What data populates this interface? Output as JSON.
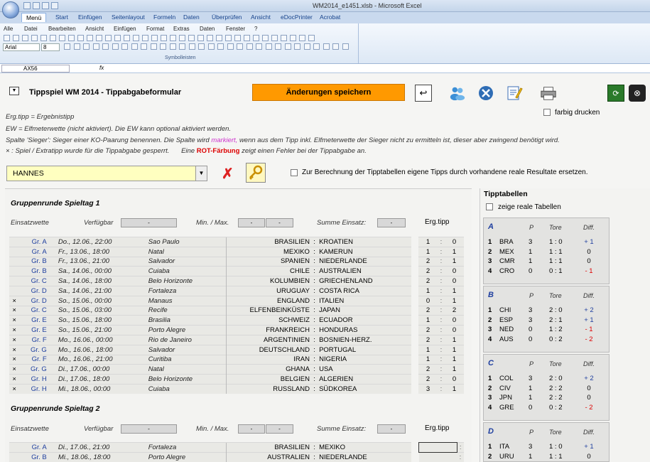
{
  "window": {
    "title": "WM2014_e1451.xlsb - Microsoft Excel"
  },
  "ribbon": {
    "tabs": [
      "Menü",
      "Start",
      "Einfügen",
      "Seitenlayout",
      "Formeln",
      "Daten",
      "Überprüfen",
      "Ansicht",
      "eDocPrinter",
      "Acrobat"
    ],
    "menus": [
      "Alle",
      "Datei",
      "Bearbeiten",
      "Ansicht",
      "Einfügen",
      "Format",
      "Extras",
      "Daten",
      "Fenster",
      "?"
    ],
    "font_name": "Arial",
    "font_size": "8",
    "group_label": "Symbolleisten"
  },
  "formula_bar": {
    "name_box": "AX56",
    "fx": "fx"
  },
  "header": {
    "title": "Tippspiel WM 2014 - Tippabgabeformular",
    "save_label": "Änderungen speichern",
    "color_print_label": "farbig drucken"
  },
  "info": {
    "line1": "Erg.tipp = Ergebnistipp",
    "line2": "EW = Elfmeterwette (nicht aktiviert). Die EW kann optional aktiviert werden.",
    "line3a": "Spalte 'Sieger': Sieger einer KO-Paarung benennen. Die Spalte wird",
    "line3b": "markiert,",
    "line3c": "wenn aus dem Tipp inkl. Elfmeterwette der Sieger nicht zu ermitteln ist, dieser aber zwingend benötigt wird.",
    "line4a": "× : Spiel / Extratipp wurde für die Tippabgabe gesperrt.",
    "line4b": "Eine",
    "line4c": "ROT-Färbung",
    "line4d": "zeigt einen Fehler bei der Tippabgabe an."
  },
  "player": {
    "name": "HANNES",
    "replace_label": "Zur Berechnung der Tipptabellen eigene Tipps durch vorhandene reale Resultate ersetzen."
  },
  "section1": {
    "title": "Gruppenrunde Spieltag 1",
    "einsatz": "Einsatzwette",
    "verfuegbar": "Verfügbar",
    "verf_val": "-",
    "minmax": "Min. / Max.",
    "min_val": "-",
    "max_val": "-",
    "summe": "Summe Einsatz:",
    "summe_val": "-",
    "ergtipp": "Erg.tipp",
    "matches": [
      {
        "g": "Gr. A",
        "m": "",
        "d": "Do., 12.06., 22:00",
        "v": "Sao Paulo",
        "h": "BRASILIEN",
        "a": "KROATIEN",
        "t1": "1",
        "t2": "0"
      },
      {
        "g": "Gr. A",
        "m": "",
        "d": "Fr., 13.06., 18:00",
        "v": "Natal",
        "h": "MEXIKO",
        "a": "KAMERUN",
        "t1": "1",
        "t2": "1"
      },
      {
        "g": "Gr. B",
        "m": "",
        "d": "Fr., 13.06., 21:00",
        "v": "Salvador",
        "h": "SPANIEN",
        "a": "NIEDERLANDE",
        "t1": "2",
        "t2": "1"
      },
      {
        "g": "Gr. B",
        "m": "",
        "d": "Sa., 14.06., 00:00",
        "v": "Cuiaba",
        "h": "CHILE",
        "a": "AUSTRALIEN",
        "t1": "2",
        "t2": "0"
      },
      {
        "g": "Gr. C",
        "m": "",
        "d": "Sa., 14.06., 18:00",
        "v": "Belo Horizonte",
        "h": "KOLUMBIEN",
        "a": "GRIECHENLAND",
        "t1": "2",
        "t2": "0"
      },
      {
        "g": "Gr. D",
        "m": "",
        "d": "Sa., 14.06., 21:00",
        "v": "Fortaleza",
        "h": "URUGUAY",
        "a": "COSTA RICA",
        "t1": "1",
        "t2": "1"
      },
      {
        "g": "Gr. D",
        "m": "×",
        "d": "So., 15.06., 00:00",
        "v": "Manaus",
        "h": "ENGLAND",
        "a": "ITALIEN",
        "t1": "0",
        "t2": "1"
      },
      {
        "g": "Gr. C",
        "m": "×",
        "d": "So., 15.06., 03:00",
        "v": "Recife",
        "h": "ELFENBEINKÜSTE",
        "a": "JAPAN",
        "t1": "2",
        "t2": "2"
      },
      {
        "g": "Gr. E",
        "m": "×",
        "d": "So., 15.06., 18:00",
        "v": "Brasilia",
        "h": "SCHWEIZ",
        "a": "ECUADOR",
        "t1": "1",
        "t2": "0"
      },
      {
        "g": "Gr. E",
        "m": "×",
        "d": "So., 15.06., 21:00",
        "v": "Porto Alegre",
        "h": "FRANKREICH",
        "a": "HONDURAS",
        "t1": "2",
        "t2": "0"
      },
      {
        "g": "Gr. F",
        "m": "×",
        "d": "Mo., 16.06., 00:00",
        "v": "Rio de Janeiro",
        "h": "ARGENTINIEN",
        "a": "BOSNIEN-HERZ.",
        "t1": "2",
        "t2": "1"
      },
      {
        "g": "Gr. G",
        "m": "×",
        "d": "Mo., 16.06., 18:00",
        "v": "Salvador",
        "h": "DEUTSCHLAND",
        "a": "PORTUGAL",
        "t1": "1",
        "t2": "1"
      },
      {
        "g": "Gr. F",
        "m": "×",
        "d": "Mo., 16.06., 21:00",
        "v": "Curitiba",
        "h": "IRAN",
        "a": "NIGERIA",
        "t1": "1",
        "t2": "1"
      },
      {
        "g": "Gr. G",
        "m": "×",
        "d": "Di., 17.06., 00:00",
        "v": "Natal",
        "h": "GHANA",
        "a": "USA",
        "t1": "2",
        "t2": "1"
      },
      {
        "g": "Gr. H",
        "m": "×",
        "d": "Di., 17.06., 18:00",
        "v": "Belo Horizonte",
        "h": "BELGIEN",
        "a": "ALGERIEN",
        "t1": "2",
        "t2": "0"
      },
      {
        "g": "Gr. H",
        "m": "×",
        "d": "Mi., 18.06., 00:00",
        "v": "Cuiaba",
        "h": "RUSSLAND",
        "a": "SÜDKOREA",
        "t1": "3",
        "t2": "1"
      }
    ]
  },
  "section2": {
    "title": "Gruppenrunde Spieltag 2",
    "einsatz": "Einsatzwette",
    "verfuegbar": "Verfügbar",
    "verf_val": "-",
    "minmax": "Min. / Max.",
    "min_val": "-",
    "max_val": "-",
    "summe": "Summe Einsatz:",
    "summe_val": "-",
    "ergtipp": "Erg.tipp",
    "matches": [
      {
        "g": "Gr. A",
        "m": "",
        "d": "Di., 17.06., 21:00",
        "v": "Fortaleza",
        "h": "BRASILIEN",
        "a": "MEXIKO",
        "t1": "",
        "t2": ""
      },
      {
        "g": "Gr. B",
        "m": "",
        "d": "Mi., 18.06., 18:00",
        "v": "Porto Alegre",
        "h": "AUSTRALIEN",
        "a": "NIEDERLANDE",
        "t1": "",
        "t2": ""
      }
    ]
  },
  "tipptabellen": {
    "title": "Tipptabellen",
    "real_label": "zeige reale Tabellen",
    "headers": {
      "p": "P",
      "tore": "Tore",
      "diff": "Diff."
    },
    "groups": [
      {
        "label": "A",
        "rows": [
          {
            "pos": "1",
            "team": "BRA",
            "p": "3",
            "tore": "1 : 0",
            "diff": "+ 1",
            "sign": "pos"
          },
          {
            "pos": "2",
            "team": "MEX",
            "p": "1",
            "tore": "1 : 1",
            "diff": "0",
            "sign": "zero"
          },
          {
            "pos": "3",
            "team": "CMR",
            "p": "1",
            "tore": "1 : 1",
            "diff": "0",
            "sign": "zero"
          },
          {
            "pos": "4",
            "team": "CRO",
            "p": "0",
            "tore": "0 : 1",
            "diff": "- 1",
            "sign": "neg"
          }
        ]
      },
      {
        "label": "B",
        "rows": [
          {
            "pos": "1",
            "team": "CHI",
            "p": "3",
            "tore": "2 : 0",
            "diff": "+ 2",
            "sign": "pos"
          },
          {
            "pos": "2",
            "team": "ESP",
            "p": "3",
            "tore": "2 : 1",
            "diff": "+ 1",
            "sign": "pos"
          },
          {
            "pos": "3",
            "team": "NED",
            "p": "0",
            "tore": "1 : 2",
            "diff": "- 1",
            "sign": "neg"
          },
          {
            "pos": "4",
            "team": "AUS",
            "p": "0",
            "tore": "0 : 2",
            "diff": "- 2",
            "sign": "neg"
          }
        ]
      },
      {
        "label": "C",
        "rows": [
          {
            "pos": "1",
            "team": "COL",
            "p": "3",
            "tore": "2 : 0",
            "diff": "+ 2",
            "sign": "pos"
          },
          {
            "pos": "2",
            "team": "CIV",
            "p": "1",
            "tore": "2 : 2",
            "diff": "0",
            "sign": "zero"
          },
          {
            "pos": "3",
            "team": "JPN",
            "p": "1",
            "tore": "2 : 2",
            "diff": "0",
            "sign": "zero"
          },
          {
            "pos": "4",
            "team": "GRE",
            "p": "0",
            "tore": "0 : 2",
            "diff": "- 2",
            "sign": "neg"
          }
        ]
      },
      {
        "label": "D",
        "rows": [
          {
            "pos": "1",
            "team": "ITA",
            "p": "3",
            "tore": "1 : 0",
            "diff": "+ 1",
            "sign": "pos"
          },
          {
            "pos": "2",
            "team": "URU",
            "p": "1",
            "tore": "1 : 1",
            "diff": "0",
            "sign": "zero"
          }
        ]
      }
    ]
  },
  "colors": {
    "accent": "#ff9900",
    "group": "#1f3f9f",
    "negative": "#dd0000",
    "mark": "#cc33cc"
  }
}
